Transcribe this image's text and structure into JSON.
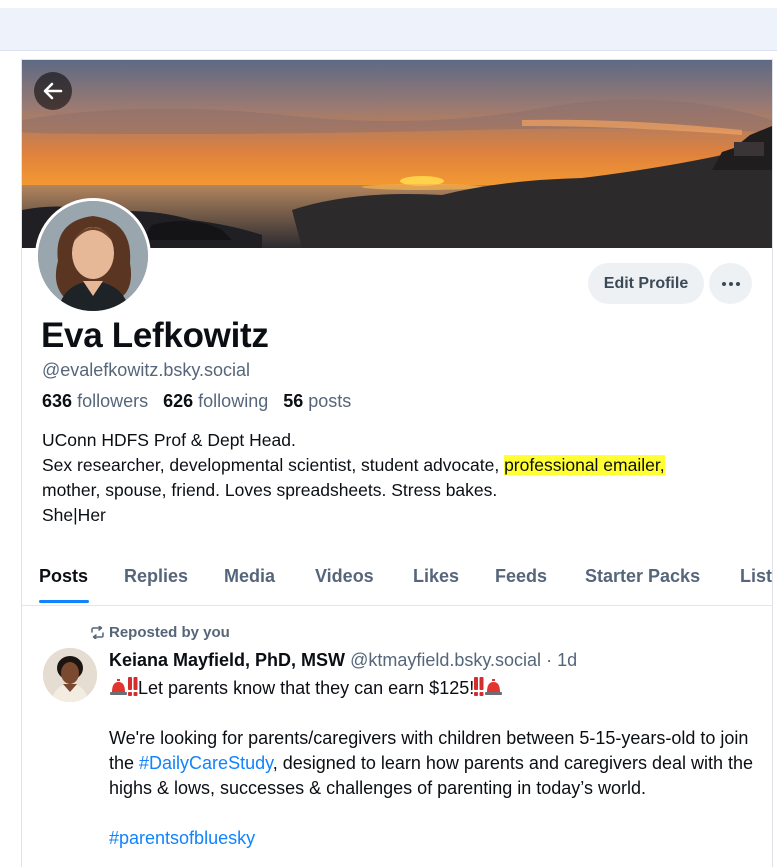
{
  "profile": {
    "display_name": "Eva Lefkowitz",
    "handle": "@evalefkowitz.bsky.social",
    "followers_count": "636",
    "followers_label": "followers",
    "following_count": "626",
    "following_label": "following",
    "posts_count": "56",
    "posts_label": "posts",
    "bio_line1": "UConn HDFS Prof & Dept Head.",
    "bio_line2_a": "Sex researcher, developmental scientist, student advocate, ",
    "bio_line2_highlight": "professional emailer,",
    "bio_line3": "mother, spouse, friend. Loves spreadsheets. Stress bakes.",
    "bio_line4": "She|Her",
    "highlight_color": "#ffff33"
  },
  "actions": {
    "edit_profile": "Edit Profile",
    "more": "···"
  },
  "tabs": [
    {
      "label": "Posts"
    },
    {
      "label": "Replies"
    },
    {
      "label": "Media"
    },
    {
      "label": "Videos"
    },
    {
      "label": "Likes"
    },
    {
      "label": "Feeds"
    },
    {
      "label": "Starter Packs"
    },
    {
      "label": "List"
    }
  ],
  "feed": {
    "repost_label": "Reposted by you",
    "author_name": "Keiana Mayfield, PhD, MSW",
    "author_handle": "@ktmayfield.bsky.social",
    "age": "· 1d",
    "line1_text": "Let parents know that they can earn $125!",
    "para2_a": "We're looking for parents/caregivers with children between 5-15-years-old to join the ",
    "hashtag1": "#DailyCareStudy",
    "para2_b": ", designed to learn how parents and caregivers deal with the highs & lows, successes & challenges of parenting in today’s world.",
    "hashtag2": "#parentsofbluesky"
  },
  "colors": {
    "accent": "#1083fe",
    "muted": "#56667a",
    "button_bg": "#eef1f4"
  },
  "icons": [
    "back-arrow-icon",
    "more-horizontal-icon",
    "repost-icon",
    "siren-icon",
    "exclamation-icon"
  ]
}
